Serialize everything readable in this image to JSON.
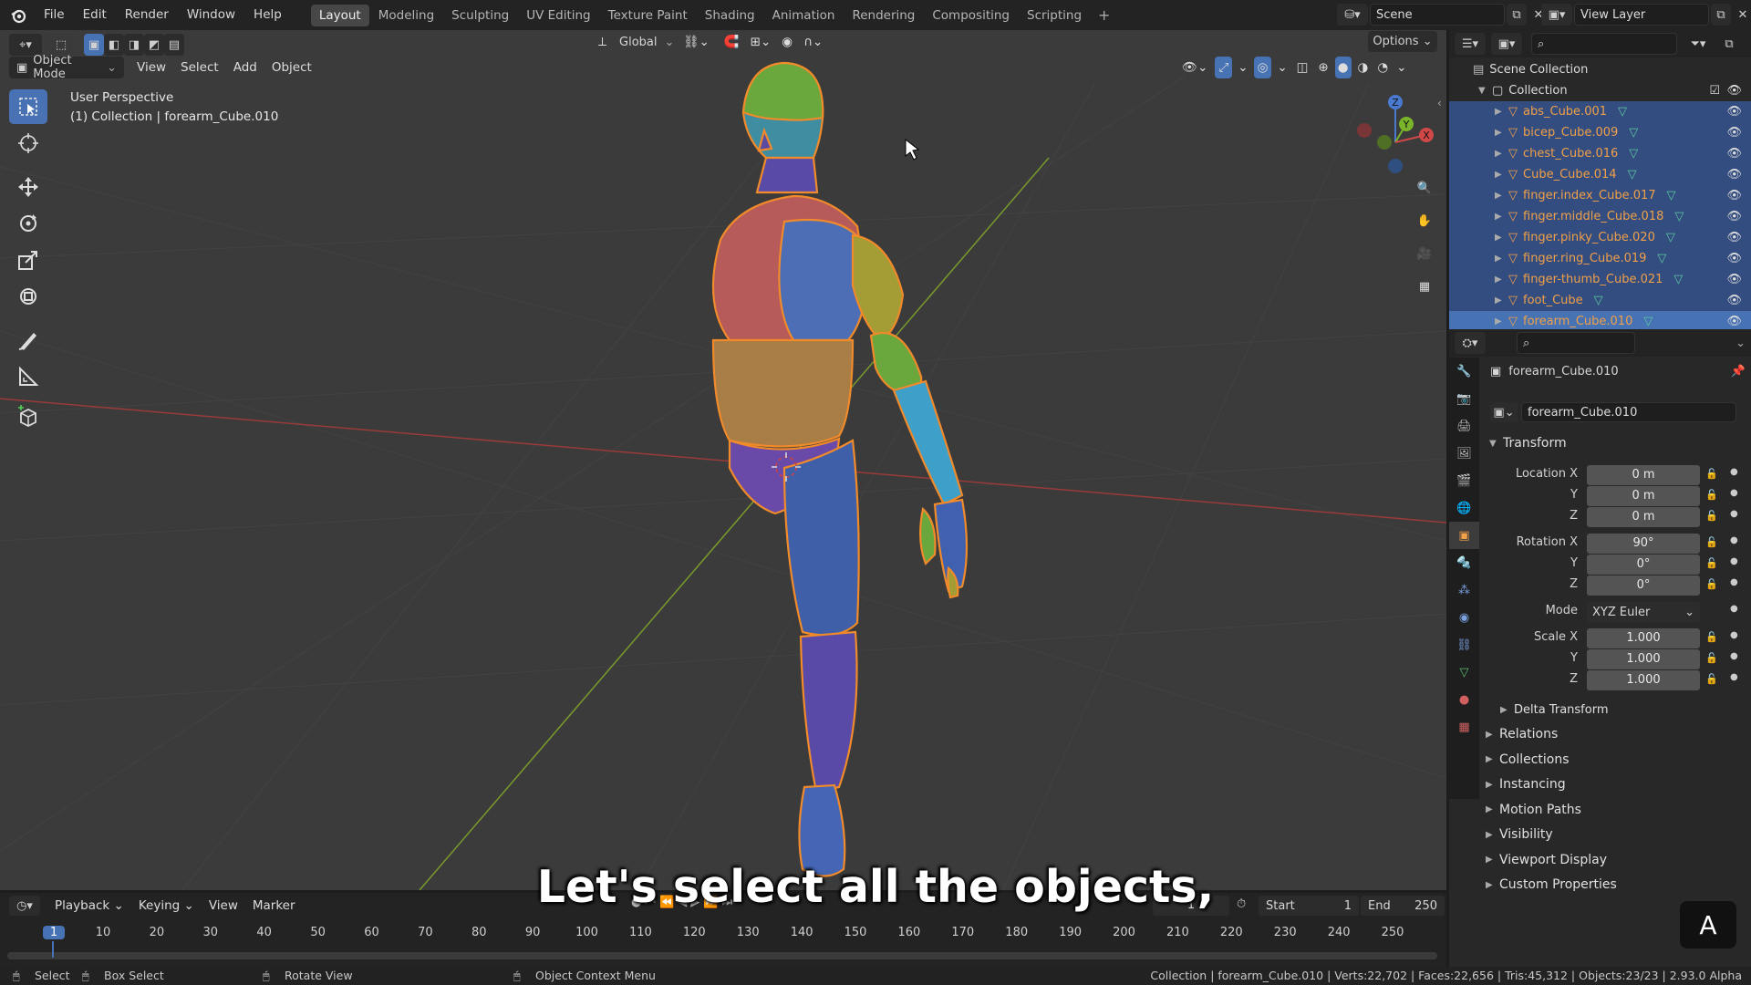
{
  "topbar": {
    "menus": [
      "File",
      "Edit",
      "Render",
      "Window",
      "Help"
    ],
    "workspaces": [
      "Layout",
      "Modeling",
      "Sculpting",
      "UV Editing",
      "Texture Paint",
      "Shading",
      "Animation",
      "Rendering",
      "Compositing",
      "Scripting"
    ],
    "active_workspace": "Layout",
    "scene_name": "Scene",
    "view_layer_name": "View Layer"
  },
  "viewport": {
    "mode": "Object Mode",
    "menus": [
      "View",
      "Select",
      "Add",
      "Object"
    ],
    "transform_orientation": "Global",
    "options_label": "Options",
    "overlay_line1": "User Perspective",
    "overlay_line2": "(1) Collection | forearm_Cube.010",
    "gizmo_axes": {
      "z": "Z",
      "y": "Y",
      "x": "X"
    }
  },
  "outliner": {
    "search_placeholder": "",
    "root": "Scene Collection",
    "collection": "Collection",
    "items": [
      "abs_Cube.001",
      "bicep_Cube.009",
      "chest_Cube.016",
      "Cube_Cube.014",
      "finger.index_Cube.017",
      "finger.middle_Cube.018",
      "finger.pinky_Cube.020",
      "finger.ring_Cube.019",
      "finger-thumb_Cube.021",
      "foot_Cube",
      "forearm_Cube.010"
    ],
    "active_item": "forearm_Cube.010"
  },
  "properties": {
    "object_name": "forearm_Cube.010",
    "datablock_name": "forearm_Cube.010",
    "transform_label": "Transform",
    "location": {
      "label": "Location X",
      "x": "0 m",
      "y_label": "Y",
      "y": "0 m",
      "z_label": "Z",
      "z": "0 m"
    },
    "rotation": {
      "label": "Rotation X",
      "x": "90°",
      "y_label": "Y",
      "y": "0°",
      "z_label": "Z",
      "z": "0°"
    },
    "mode": {
      "label": "Mode",
      "value": "XYZ Euler"
    },
    "scale": {
      "label": "Scale X",
      "x": "1.000",
      "y_label": "Y",
      "y": "1.000",
      "z_label": "Z",
      "z": "1.000"
    },
    "delta_transform": "Delta Transform",
    "panels": [
      "Relations",
      "Collections",
      "Instancing",
      "Motion Paths",
      "Visibility",
      "Viewport Display",
      "Custom Properties"
    ]
  },
  "timeline": {
    "menus": [
      "Playback",
      "Keying",
      "View",
      "Marker"
    ],
    "current_frame": "1",
    "start_label": "Start",
    "start": "1",
    "end_label": "End",
    "end": "250",
    "ruler": [
      "1",
      "10",
      "20",
      "30",
      "40",
      "50",
      "60",
      "70",
      "80",
      "90",
      "100",
      "110",
      "120",
      "130",
      "140",
      "150",
      "160",
      "170",
      "180",
      "190",
      "200",
      "210",
      "220",
      "230",
      "240",
      "250"
    ]
  },
  "statusbar": {
    "select": "Select",
    "box_select": "Box Select",
    "rotate_view": "Rotate View",
    "context_menu": "Object Context Menu",
    "stats": "Collection | forearm_Cube.010 | Verts:22,702 | Faces:22,656 | Tris:45,312 | Objects:23/23 | 2.93.0 Alpha"
  },
  "subtitle": "Let's select all the objects,",
  "keypress": "A",
  "colors": {
    "accent": "#4772b3",
    "selection": "#334d80",
    "object_name": "#f0a048",
    "outline": "#f08a2a"
  }
}
